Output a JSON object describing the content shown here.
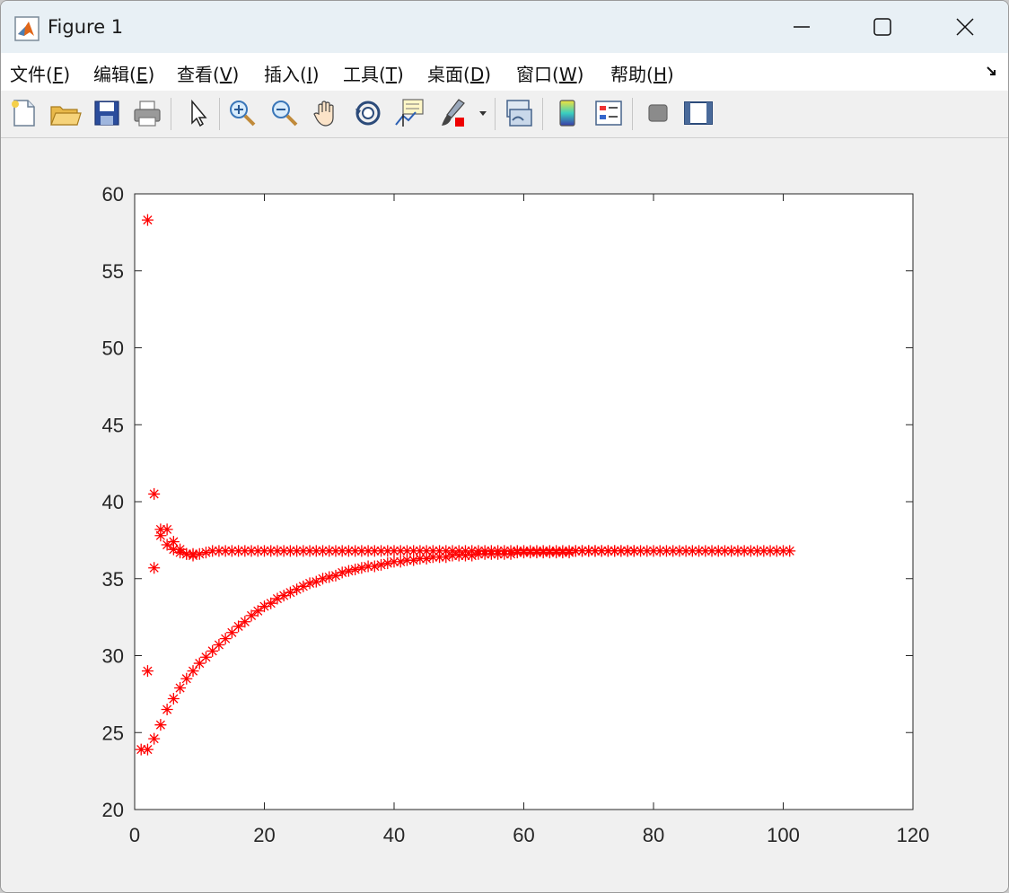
{
  "window": {
    "title": "Figure 1",
    "controls": {
      "minimize": "minimize",
      "maximize": "maximize",
      "close": "close"
    }
  },
  "menu": {
    "items": [
      {
        "label": "文件(",
        "accel": "F",
        "close": ")"
      },
      {
        "label": "编辑(",
        "accel": "E",
        "close": ")"
      },
      {
        "label": "查看(",
        "accel": "V",
        "close": ")"
      },
      {
        "label": "插入(",
        "accel": "I",
        "close": ")"
      },
      {
        "label": "工具(",
        "accel": "T",
        "close": ")"
      },
      {
        "label": "桌面(",
        "accel": "D",
        "close": ")"
      },
      {
        "label": "窗口(",
        "accel": "W",
        "close": ")"
      },
      {
        "label": "帮助(",
        "accel": "H",
        "close": ")"
      }
    ],
    "dock_icon": "dock-arrow-icon"
  },
  "toolbar": {
    "tools": [
      "new-figure-icon",
      "open-file-icon",
      "save-icon",
      "print-icon",
      "select-arrow-icon",
      "zoom-in-icon",
      "zoom-out-icon",
      "pan-hand-icon",
      "rotate-3d-icon",
      "data-cursor-icon",
      "brush-icon",
      "link-plot-icon",
      "colorbar-icon",
      "legend-icon",
      "hide-plot-tools-icon",
      "show-plot-tools-icon"
    ]
  },
  "colors": {
    "marker": "#ff0000",
    "axes_bg": "#ffffff",
    "figure_bg": "#f0f0f0",
    "titlebar_bg": "#e8f0f5"
  },
  "chart_data": {
    "type": "scatter",
    "marker": "asterisk",
    "title": "",
    "xlabel": "",
    "ylabel": "",
    "xlim": [
      0,
      120
    ],
    "ylim": [
      20,
      60
    ],
    "xticks": [
      0,
      20,
      40,
      60,
      80,
      100,
      120
    ],
    "yticks": [
      20,
      25,
      30,
      35,
      40,
      45,
      50,
      55,
      60
    ],
    "grid": false,
    "series": [
      {
        "x": [
          1,
          2,
          3,
          4,
          5,
          6,
          7,
          8,
          9,
          10,
          11,
          12,
          13,
          14,
          15,
          16,
          17,
          18,
          19,
          20,
          21,
          22,
          23,
          24,
          25,
          26,
          27,
          28,
          29,
          30,
          31,
          32,
          33,
          34,
          35,
          36,
          37,
          38,
          39,
          40,
          41,
          42,
          43,
          44,
          45,
          46,
          47,
          48,
          49,
          50,
          51,
          52,
          53,
          54,
          55,
          56,
          57,
          58,
          59,
          60,
          61,
          62,
          63,
          64,
          65,
          66,
          67,
          68,
          69,
          70,
          71,
          72,
          73,
          74,
          75,
          76,
          77,
          78,
          79,
          80,
          81,
          82,
          83,
          84,
          85,
          86,
          87,
          88,
          89,
          90,
          91,
          92,
          93,
          94,
          95,
          96,
          97,
          98,
          99,
          100,
          101
        ],
        "y": [
          23.9,
          23.9,
          24.6,
          25.5,
          26.5,
          27.2,
          27.9,
          28.5,
          29.0,
          29.5,
          29.9,
          30.3,
          30.7,
          31.1,
          31.5,
          31.9,
          32.2,
          32.6,
          32.9,
          33.2,
          33.4,
          33.7,
          33.9,
          34.1,
          34.3,
          34.5,
          34.7,
          34.8,
          35.0,
          35.1,
          35.2,
          35.4,
          35.5,
          35.6,
          35.7,
          35.8,
          35.8,
          35.9,
          36.0,
          36.1,
          36.1,
          36.2,
          36.2,
          36.3,
          36.3,
          36.4,
          36.4,
          36.4,
          36.5,
          36.5,
          36.5,
          36.5,
          36.6,
          36.6,
          36.6,
          36.6,
          36.6,
          36.6,
          36.7,
          36.7,
          36.7,
          36.7,
          36.7,
          36.7,
          36.7,
          36.7,
          36.7,
          36.8,
          36.8,
          36.8,
          36.8,
          36.8,
          36.8,
          36.8,
          36.8,
          36.8,
          36.8,
          36.8,
          36.8,
          36.8,
          36.8,
          36.8,
          36.8,
          36.8,
          36.8,
          36.8,
          36.8,
          36.8,
          36.8,
          36.8,
          36.8,
          36.8,
          36.8,
          36.8,
          36.8,
          36.8,
          36.8,
          36.8,
          36.8,
          36.8,
          36.8
        ]
      },
      {
        "x": [
          2,
          3,
          4,
          5,
          6,
          7,
          8,
          9,
          10,
          11,
          12,
          13,
          14,
          15,
          16,
          17,
          18,
          19,
          20,
          21,
          22,
          23,
          24,
          25,
          26,
          27,
          28,
          29,
          30,
          31,
          32,
          33,
          34,
          35,
          36,
          37,
          38,
          39,
          40,
          41,
          42,
          43,
          44,
          45,
          46,
          47,
          48,
          49,
          50,
          51,
          52,
          53,
          54,
          55,
          56,
          57,
          58,
          59,
          60,
          61,
          62,
          63,
          64,
          65,
          66,
          67,
          68,
          69,
          70,
          71,
          72,
          73,
          74,
          75,
          76,
          77
        ],
        "y": [
          58.3,
          40.5,
          38.2,
          38.2,
          37.4,
          36.9,
          36.6,
          36.5,
          36.6,
          36.7,
          36.8,
          36.8,
          36.8,
          36.8,
          36.8,
          36.8,
          36.8,
          36.8,
          36.8,
          36.8,
          36.8,
          36.8,
          36.8,
          36.8,
          36.8,
          36.8,
          36.8,
          36.8,
          36.8,
          36.8,
          36.8,
          36.8,
          36.8,
          36.8,
          36.8,
          36.8,
          36.8,
          36.8,
          36.8,
          36.8,
          36.8,
          36.8,
          36.8,
          36.8,
          36.8,
          36.8,
          36.8,
          36.8,
          36.8,
          36.8,
          36.8,
          36.8,
          36.8,
          36.8,
          36.8,
          36.8,
          36.8,
          36.8,
          36.8,
          36.8,
          36.8,
          36.8,
          36.8,
          36.8,
          36.8,
          36.8,
          36.8,
          36.8,
          36.8,
          36.8,
          36.8,
          36.8,
          36.8,
          36.8,
          36.8,
          36.8
        ]
      },
      {
        "x": [
          2,
          3,
          4,
          5,
          6,
          7,
          8,
          9
        ],
        "y": [
          29.0,
          35.7,
          37.8,
          37.2,
          36.9,
          36.7,
          36.6,
          36.6
        ]
      }
    ]
  }
}
